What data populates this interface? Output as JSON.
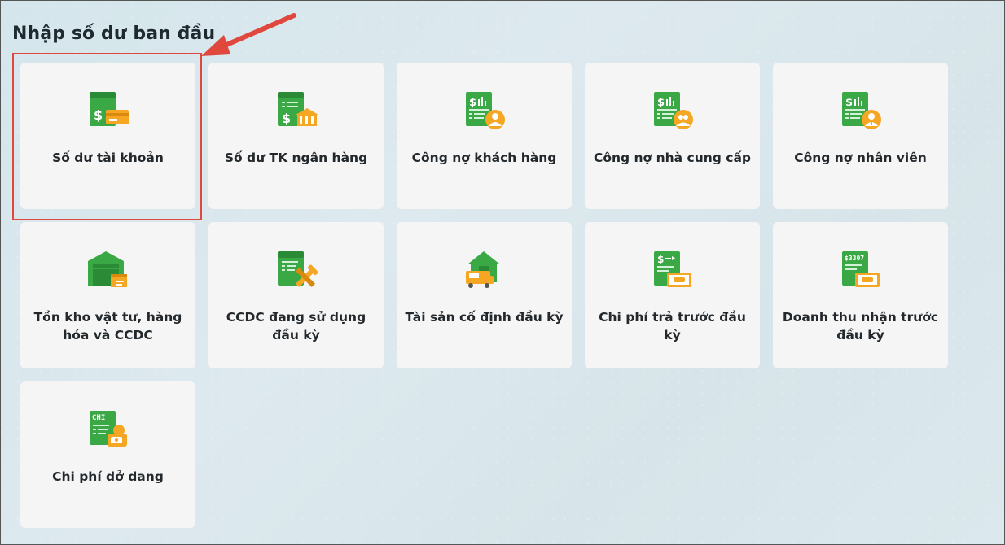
{
  "page": {
    "title": "Nhập số dư ban đầu"
  },
  "cards": [
    {
      "label": "Số dư tài khoản",
      "icon": "account-balance-icon"
    },
    {
      "label": "Số dư TK ngân hàng",
      "icon": "bank-balance-icon"
    },
    {
      "label": "Công nợ khách hàng",
      "icon": "customer-debt-icon"
    },
    {
      "label": "Công nợ nhà cung cấp",
      "icon": "supplier-debt-icon"
    },
    {
      "label": "Công nợ nhân viên",
      "icon": "employee-debt-icon"
    },
    {
      "label": "Tồn kho vật tư, hàng hóa và CCDC",
      "icon": "warehouse-inventory-icon"
    },
    {
      "label": "CCDC đang sử dụng đầu kỳ",
      "icon": "tools-in-use-icon"
    },
    {
      "label": "Tài sản cố định đầu kỳ",
      "icon": "fixed-asset-icon"
    },
    {
      "label": "Chi phí trả trước đầu kỳ",
      "icon": "prepaid-expense-icon"
    },
    {
      "label": "Doanh thu nhận trước đầu kỳ",
      "icon": "unearned-revenue-icon"
    },
    {
      "label": "Chi phí dở dang",
      "icon": "wip-cost-icon"
    }
  ],
  "icon_labels": {
    "unearned_revenue": "$3307",
    "wip_cost": "CHI"
  },
  "colors": {
    "card_bg": "#f5f5f5",
    "icon_green": "#3aa845",
    "icon_dark_green": "#2b8a36",
    "icon_orange": "#f5a623",
    "highlight_red": "#e0473d"
  }
}
